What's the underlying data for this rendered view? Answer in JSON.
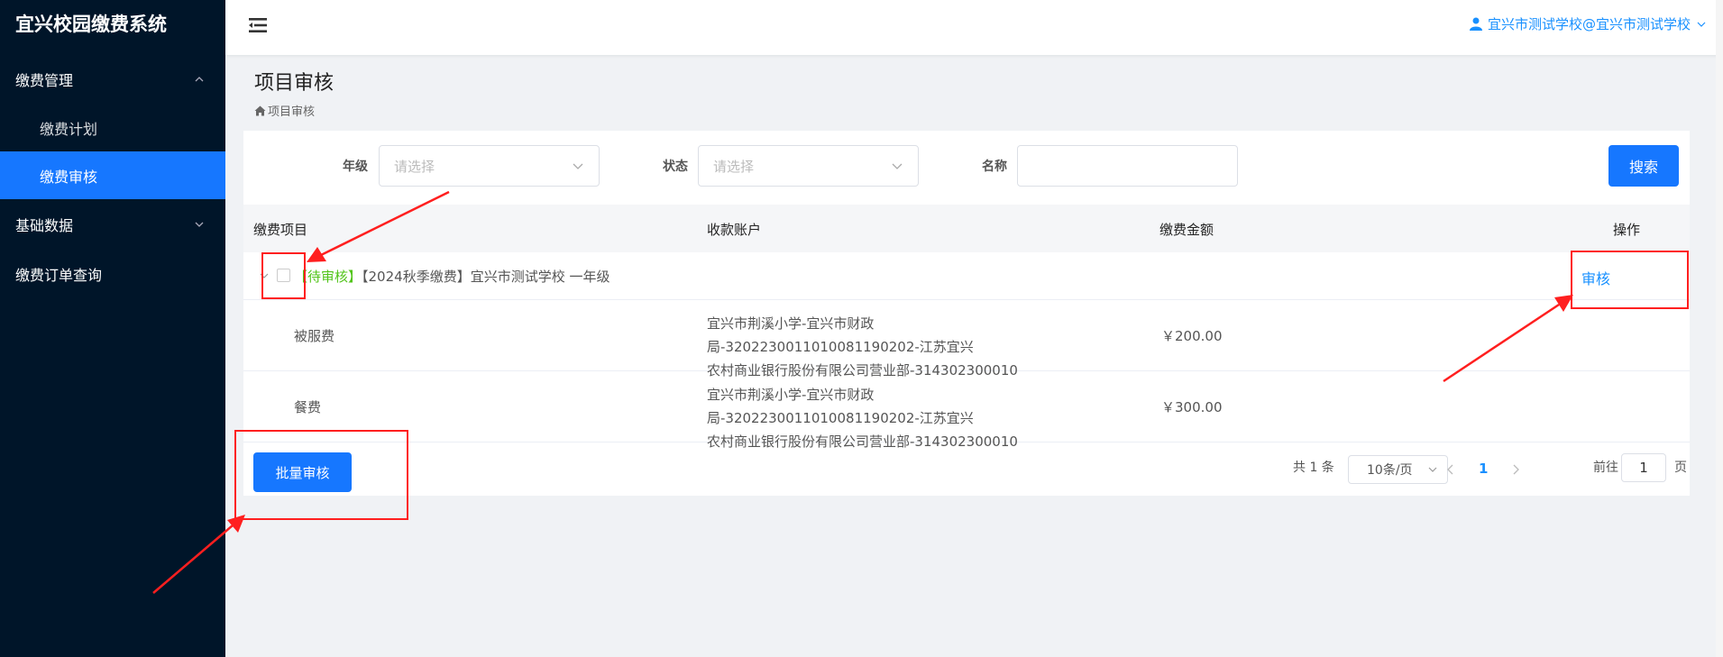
{
  "app": {
    "title": "宜兴校园缴费系统"
  },
  "sidebar": {
    "groups": [
      {
        "label": "缴费管理",
        "expanded": true,
        "items": [
          {
            "label": "缴费计划"
          },
          {
            "label": "缴费审核",
            "active": true
          }
        ]
      },
      {
        "label": "基础数据",
        "expanded": false
      },
      {
        "label": "缴费订单查询"
      }
    ]
  },
  "header": {
    "menu_icon": "menu-fold-icon",
    "user": "宜兴市测试学校@宜兴市测试学校",
    "user_icon": "user-icon"
  },
  "page": {
    "title": "项目审核",
    "breadcrumb": "项目审核",
    "breadcrumb_icon": "home-icon"
  },
  "filters": {
    "grade": {
      "label": "年级",
      "placeholder": "请选择"
    },
    "status": {
      "label": "状态",
      "placeholder": "请选择"
    },
    "name": {
      "label": "名称",
      "value": ""
    },
    "search_label": "搜索"
  },
  "table": {
    "columns": [
      "缴费项目",
      "收款账户",
      "缴费金额",
      "操作"
    ],
    "group": {
      "status_tag": "【待审核】",
      "title": "【2024秋季缴费】宜兴市测试学校 一年级",
      "action": "审核"
    },
    "rows": [
      {
        "item": "被服费",
        "account_line1": "宜兴市荆溪小学-宜兴市财政局-320223001101008119020​2-江苏宜兴",
        "account_line2": "农村商业银行股份有限公司营业部-314302300010",
        "amount": "￥200.00"
      },
      {
        "item": "餐费",
        "account_line1": "宜兴市荆溪小学-宜兴市财政局-320223001101008119020​2-江苏宜兴",
        "account_line2": "农村商业银行股份有限公司营业部-314302300010",
        "amount": "￥300.00"
      }
    ]
  },
  "footer": {
    "batch_label": "批量审核",
    "total": "共 1 条",
    "page_size": "10条/页",
    "current_page": "1",
    "goto_prefix": "前往",
    "goto_value": "1",
    "goto_suffix": "页"
  },
  "colors": {
    "sidebar": "#001529",
    "accent": "#1677ff",
    "pending": "#52c41a",
    "annotation": "#ff1f1f"
  }
}
